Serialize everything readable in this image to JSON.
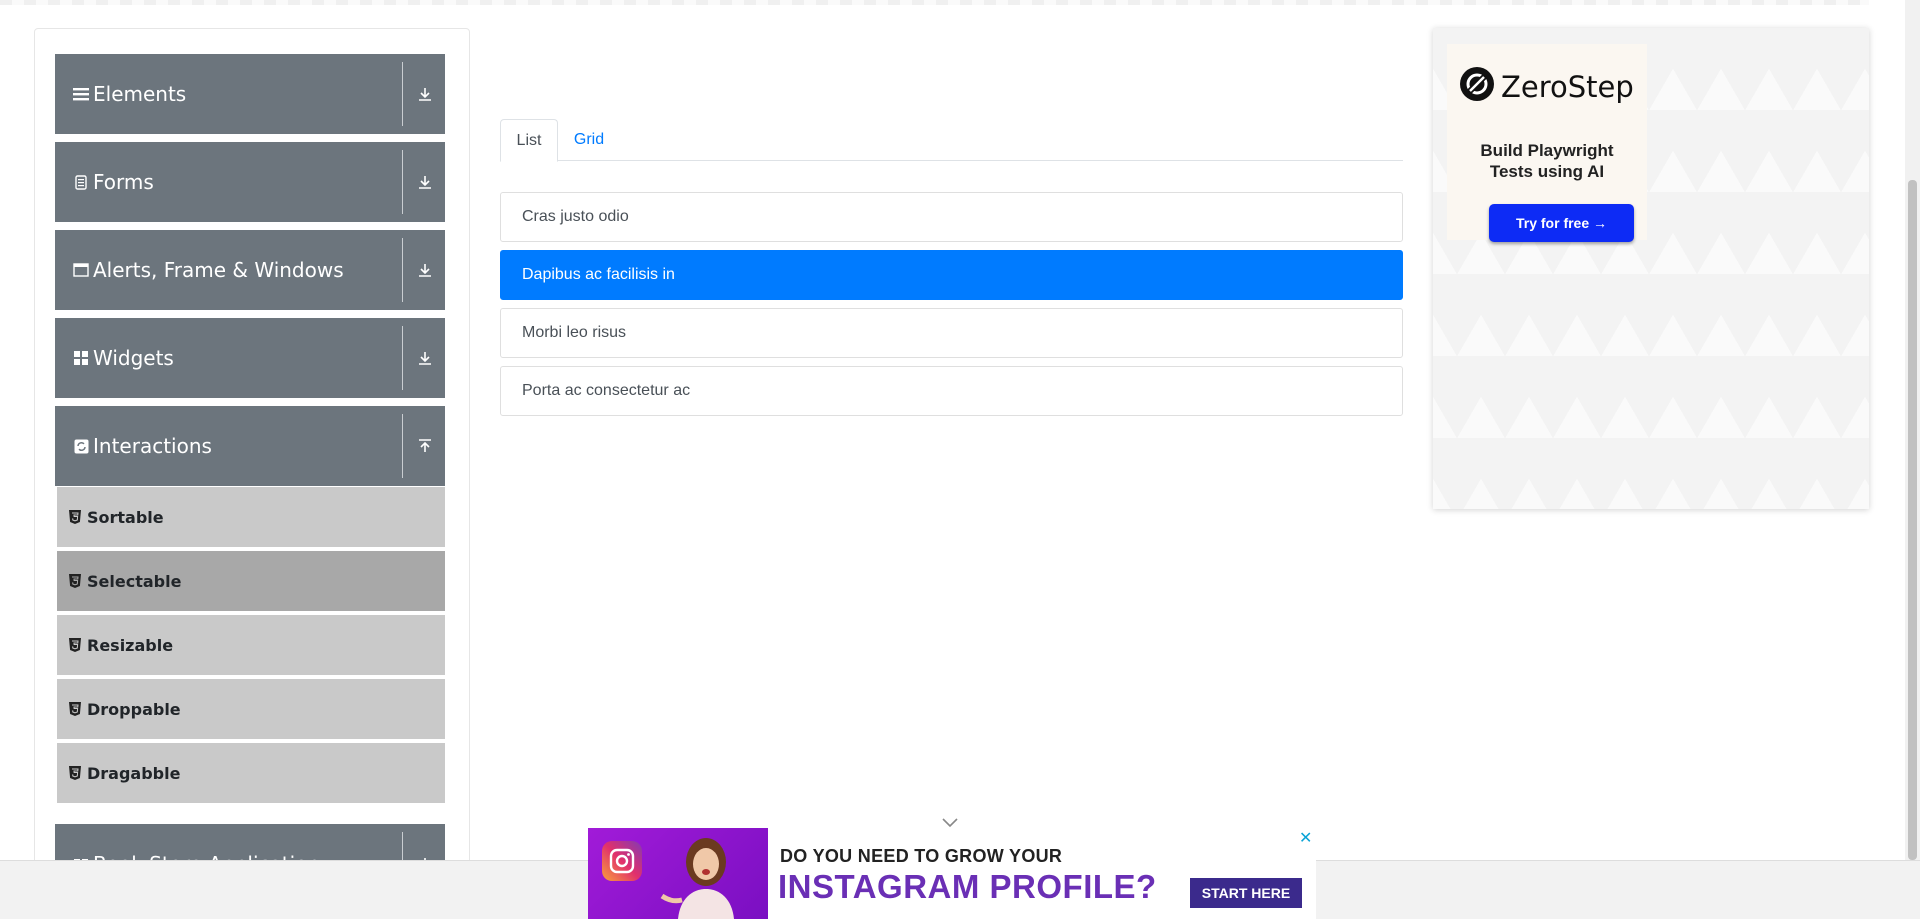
{
  "sidebar": {
    "groups": [
      {
        "label": "Elements",
        "icon": "hamburger-icon",
        "arrow": "download-icon"
      },
      {
        "label": "Forms",
        "icon": "document-icon",
        "arrow": "download-icon"
      },
      {
        "label": "Alerts, Frame & Windows",
        "icon": "window-icon",
        "arrow": "download-icon"
      },
      {
        "label": "Widgets",
        "icon": "grid-icon",
        "arrow": "download-icon"
      },
      {
        "label": "Interactions",
        "icon": "refresh-icon",
        "arrow": "upload-icon"
      },
      {
        "label": "Book Store Application",
        "icon": "book-icon",
        "arrow": "download-icon"
      }
    ],
    "items": [
      {
        "label": "Sortable",
        "active": false
      },
      {
        "label": "Selectable",
        "active": true
      },
      {
        "label": "Resizable",
        "active": false
      },
      {
        "label": "Droppable",
        "active": false
      },
      {
        "label": "Dragabble",
        "active": false
      }
    ]
  },
  "tabs": [
    {
      "label": "List",
      "active": true
    },
    {
      "label": "Grid",
      "active": false
    }
  ],
  "list": [
    {
      "label": "Cras justo odio",
      "selected": false
    },
    {
      "label": "Dapibus ac facilisis in",
      "selected": true
    },
    {
      "label": "Morbi leo risus",
      "selected": false
    },
    {
      "label": "Porta ac consectetur ac",
      "selected": false
    }
  ],
  "ad_right": {
    "brand": "ZeroStep",
    "tagline_1": "Build Playwright",
    "tagline_2": "Tests using AI",
    "cta": "Try for free →"
  },
  "ad_bottom": {
    "line1": "DO YOU NEED TO GROW YOUR",
    "line2": "INSTAGRAM PROFILE?",
    "cta": "START HERE",
    "close": "✕"
  },
  "colors": {
    "sidebar_group": "#6c757d",
    "sidebar_item": "#c9c9c9",
    "sidebar_item_active": "#a8a8a8",
    "selected_list_item": "#007bff",
    "tab_link": "#007bff",
    "zerostep_button": "#0d2bf5"
  }
}
